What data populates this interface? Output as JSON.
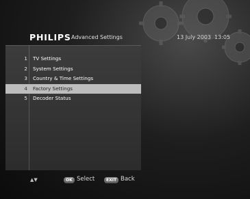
{
  "header": {
    "brand": "PHILIPS",
    "title": "Advanced Settings",
    "date": "13 July 2003",
    "time": "13:05"
  },
  "menu": {
    "items": [
      {
        "number": "1",
        "label": "TV Settings",
        "selected": false
      },
      {
        "number": "2",
        "label": "System Settings",
        "selected": false
      },
      {
        "number": "3",
        "label": "Country & Time Settings",
        "selected": false
      },
      {
        "number": "4",
        "label": "Factory Settings",
        "selected": true
      },
      {
        "number": "5",
        "label": "Decoder Status",
        "selected": false
      }
    ]
  },
  "footer": {
    "nav_arrows": "▲▼",
    "ok_key": "OK",
    "select_label": "Select",
    "exit_key": "EXIT",
    "back_label": "Back"
  },
  "colors": {
    "background": "#1e1e1e",
    "panel": "#353535",
    "selection": "#bdbdbd",
    "text": "#ffffff"
  },
  "icons": {
    "decoration": "gears-icon",
    "navigation": "up-down-arrows-icon"
  }
}
